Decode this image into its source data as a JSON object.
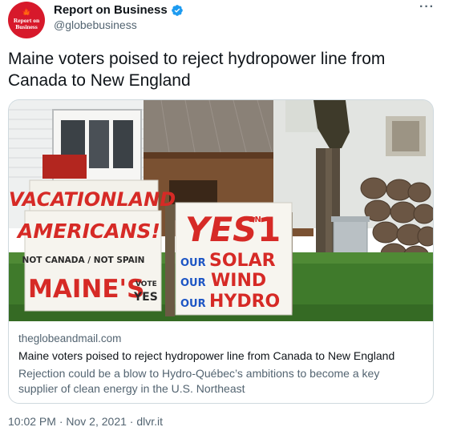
{
  "author": {
    "display_name": "Report on Business",
    "handle": "@globebusiness",
    "avatar_text": [
      "Report on",
      "Business"
    ],
    "verified": true
  },
  "tweet": {
    "text": "Maine voters poised to reject hydropower line from Canada to New England"
  },
  "card": {
    "domain": "theglobeandmail.com",
    "title": "Maine voters poised to reject hydropower line from Canada to New England",
    "description": "Rejection could be a blow to Hydro-Québec’s ambitions to become a key supplier of clean energy in the U.S. Northeast",
    "image_signs": {
      "left_top": "VACATIONLAND",
      "left_main": "AMERICANS!",
      "left_sub": "NOT CANADA / NOT SPAIN",
      "left_bottom": "MAINE'S",
      "left_vote1": "VOTE",
      "left_vote2": "YES",
      "right_yes": "YES",
      "right_on": "ON",
      "right_one": "1",
      "right_our1": "OUR",
      "right_solar": "SOLAR",
      "right_our2": "OUR",
      "right_wind": "WIND",
      "right_our3": "OUR",
      "right_hydro": "HYDRO"
    }
  },
  "meta": {
    "time": "10:02 PM",
    "sep": " · ",
    "date": "Nov 2, 2021",
    "source": "dlvr.it"
  },
  "colors": {
    "avatar": "#d7192b",
    "verified": "#1d9bf0",
    "secondary_text": "#536471",
    "sign_red": "#d62a26",
    "sign_blue": "#1d55c4"
  }
}
